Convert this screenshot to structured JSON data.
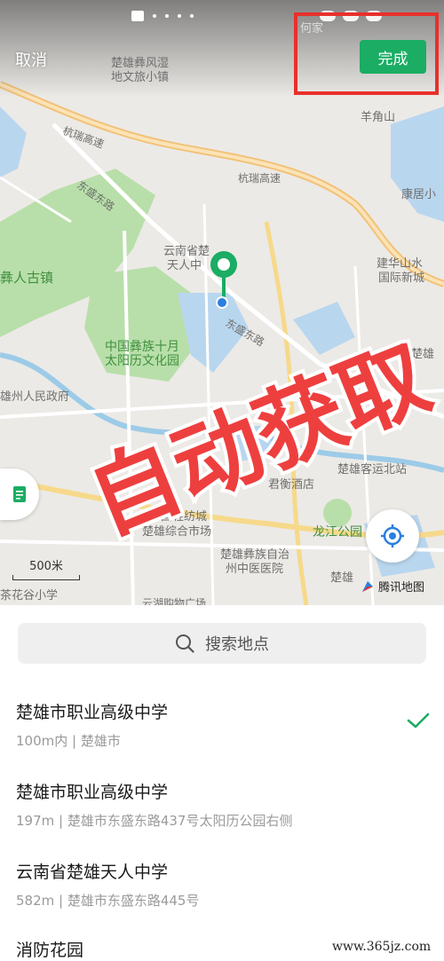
{
  "header": {
    "cancel_label": "取消",
    "done_label": "完成"
  },
  "map": {
    "labels": {
      "town1": "楚雄彝风湿",
      "town1b": "地文旅小镇",
      "yangjiaoshan": "羊角山",
      "kangju": "康居小",
      "hangrui1": "杭瑞高速",
      "hangrui2": "杭瑞高速",
      "donglu": "东盛东路",
      "yi_ancient": "彝人古镇",
      "school1": "云南省楚",
      "school1b": "天人中",
      "yizu": "中国彝族十月",
      "yizu_b": "太阳历文化园",
      "jianshe": "建华山水",
      "jianshe_b": "国际新城",
      "govt": "雄州人民政府",
      "donglu2": "东盛东路",
      "bus": "楚雄客运北站",
      "hotel": "君衡酒店",
      "textile": "中国轻纺城",
      "market": "楚雄综合市场",
      "longjiang": "龙江公园",
      "hospital": "楚雄彝族自治",
      "hospital_b": "州中医医院",
      "chuxiong_r": "楚雄",
      "hejia": "何家",
      "school2": "茶花谷小学",
      "bottom": "云湖购物广场",
      "he_chuxiong": "河楚雄"
    },
    "overlay_text": "自动获取",
    "scale_label": "500米",
    "attribution": "腾讯地图"
  },
  "search": {
    "placeholder": "搜索地点"
  },
  "poi_list": [
    {
      "name": "楚雄市职业高级中学",
      "address": "100m内 | 楚雄市",
      "selected": true
    },
    {
      "name": "楚雄市职业高级中学",
      "address": "197m | 楚雄市东盛东路437号太阳历公园右侧",
      "selected": false
    },
    {
      "name": "云南省楚雄天人中学",
      "address": "582m | 楚雄市东盛东路445号",
      "selected": false
    },
    {
      "name": "消防花园",
      "address": "",
      "selected": false
    }
  ],
  "watermark": "www.365jz.com",
  "colors": {
    "accent_green": "#1aad63",
    "highlight_red": "#e8302c",
    "overlay_red": "#ee3f3f"
  },
  "icons": {
    "search": "search-icon",
    "check": "checkmark-icon",
    "locate": "locate-icon",
    "pin": "location-pin-icon",
    "sheet": "document-icon"
  }
}
